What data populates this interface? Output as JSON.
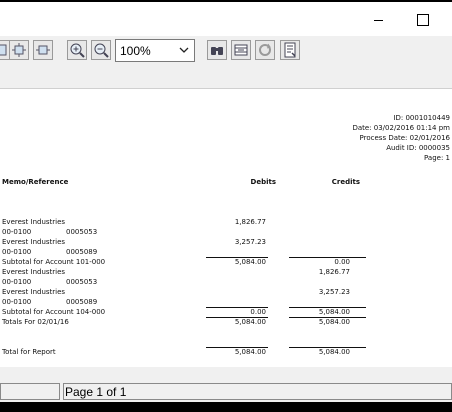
{
  "toolbar": {
    "zoom_value": "100%"
  },
  "report_header": {
    "id_line": "ID: 0001010449",
    "date_line": "Date: 03/02/2016 01:14 pm",
    "process_date_line": "Process Date: 02/01/2016",
    "audit_id_line": "Audit ID: 0000035",
    "page_line": "Page: 1"
  },
  "columns": {
    "memo": "Memo/Reference",
    "debits": "Debits",
    "credits": "Credits"
  },
  "rows": [
    {
      "memo": "Everest Industries",
      "ref": "",
      "debit": "1,826.77",
      "credit": ""
    },
    {
      "memo": "00-0100",
      "ref": "0005053",
      "debit": "",
      "credit": ""
    },
    {
      "memo": "Everest Industries",
      "ref": "",
      "debit": "3,257.23",
      "credit": ""
    },
    {
      "memo": "00-0100",
      "ref": "0005089",
      "debit": "",
      "credit": ""
    },
    {
      "memo": "Subtotal for Account 101-000",
      "ref": "",
      "debit": "5,084.00",
      "credit": "0.00"
    },
    {
      "memo": "Everest Industries",
      "ref": "",
      "debit": "",
      "credit": "1,826.77"
    },
    {
      "memo": "00-0100",
      "ref": "0005053",
      "debit": "",
      "credit": ""
    },
    {
      "memo": "Everest Industries",
      "ref": "",
      "debit": "",
      "credit": "3,257.23"
    },
    {
      "memo": "00-0100",
      "ref": "0005089",
      "debit": "",
      "credit": ""
    },
    {
      "memo": "Subtotal for Account 104-000",
      "ref": "",
      "debit": "0.00",
      "credit": "5,084.00"
    },
    {
      "memo": "Totals For 02/01/16",
      "ref": "",
      "debit": "5,084.00",
      "credit": "5,084.00"
    }
  ],
  "report_total": {
    "label": "Total for Report",
    "debit": "5,084.00",
    "credit": "5,084.00"
  },
  "status": {
    "page_text": "Page 1 of 1"
  }
}
